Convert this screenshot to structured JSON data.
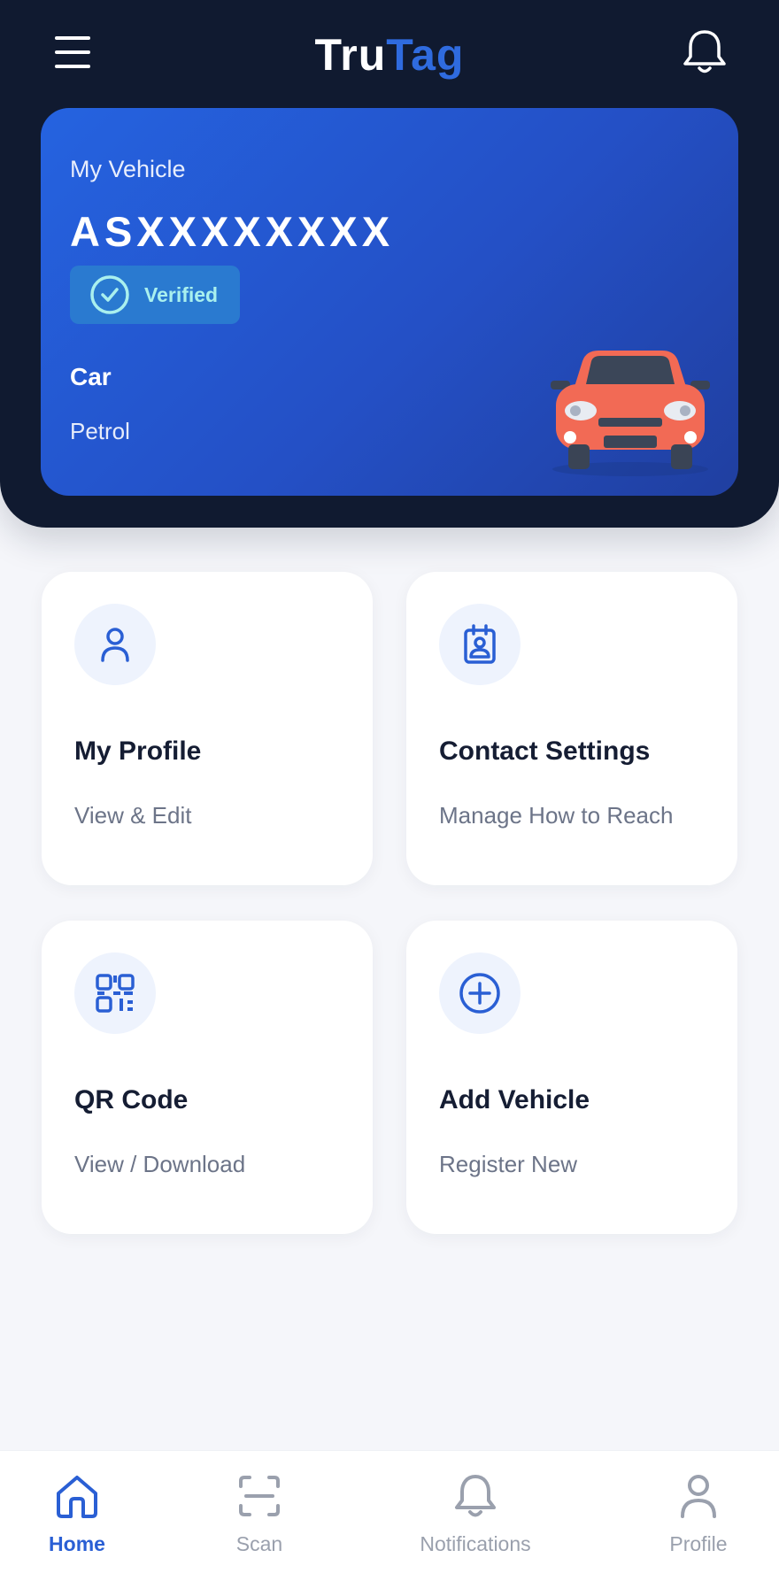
{
  "app": {
    "brand_part1": "Tru",
    "brand_part2": "Tag"
  },
  "colors": {
    "header_bg": "#101a30",
    "accent": "#2f6bdf",
    "card_gradient_start": "#2563e0",
    "card_gradient_end": "#203fa0",
    "verified_text": "#a9f0ee",
    "car": "#f26a55"
  },
  "vehicle": {
    "label": "My Vehicle",
    "plate": "ASXXXXXXXX",
    "status": "Verified",
    "type": "Car",
    "fuel": "Petrol"
  },
  "cards": [
    {
      "title": "My Profile",
      "subtitle": "View & Edit",
      "icon": "user-icon"
    },
    {
      "title": "Contact Settings",
      "subtitle": "Manage How to Reach",
      "icon": "contact-card-icon"
    },
    {
      "title": "QR Code",
      "subtitle": "View / Download",
      "icon": "qr-code-icon"
    },
    {
      "title": "Add Vehicle",
      "subtitle": "Register New",
      "icon": "plus-circle-icon"
    }
  ],
  "nav": [
    {
      "label": "Home",
      "icon": "home-icon",
      "active": true
    },
    {
      "label": "Scan",
      "icon": "scan-icon",
      "active": false
    },
    {
      "label": "Notifications",
      "icon": "bell-icon",
      "active": false
    },
    {
      "label": "Profile",
      "icon": "user-icon",
      "active": false
    }
  ]
}
